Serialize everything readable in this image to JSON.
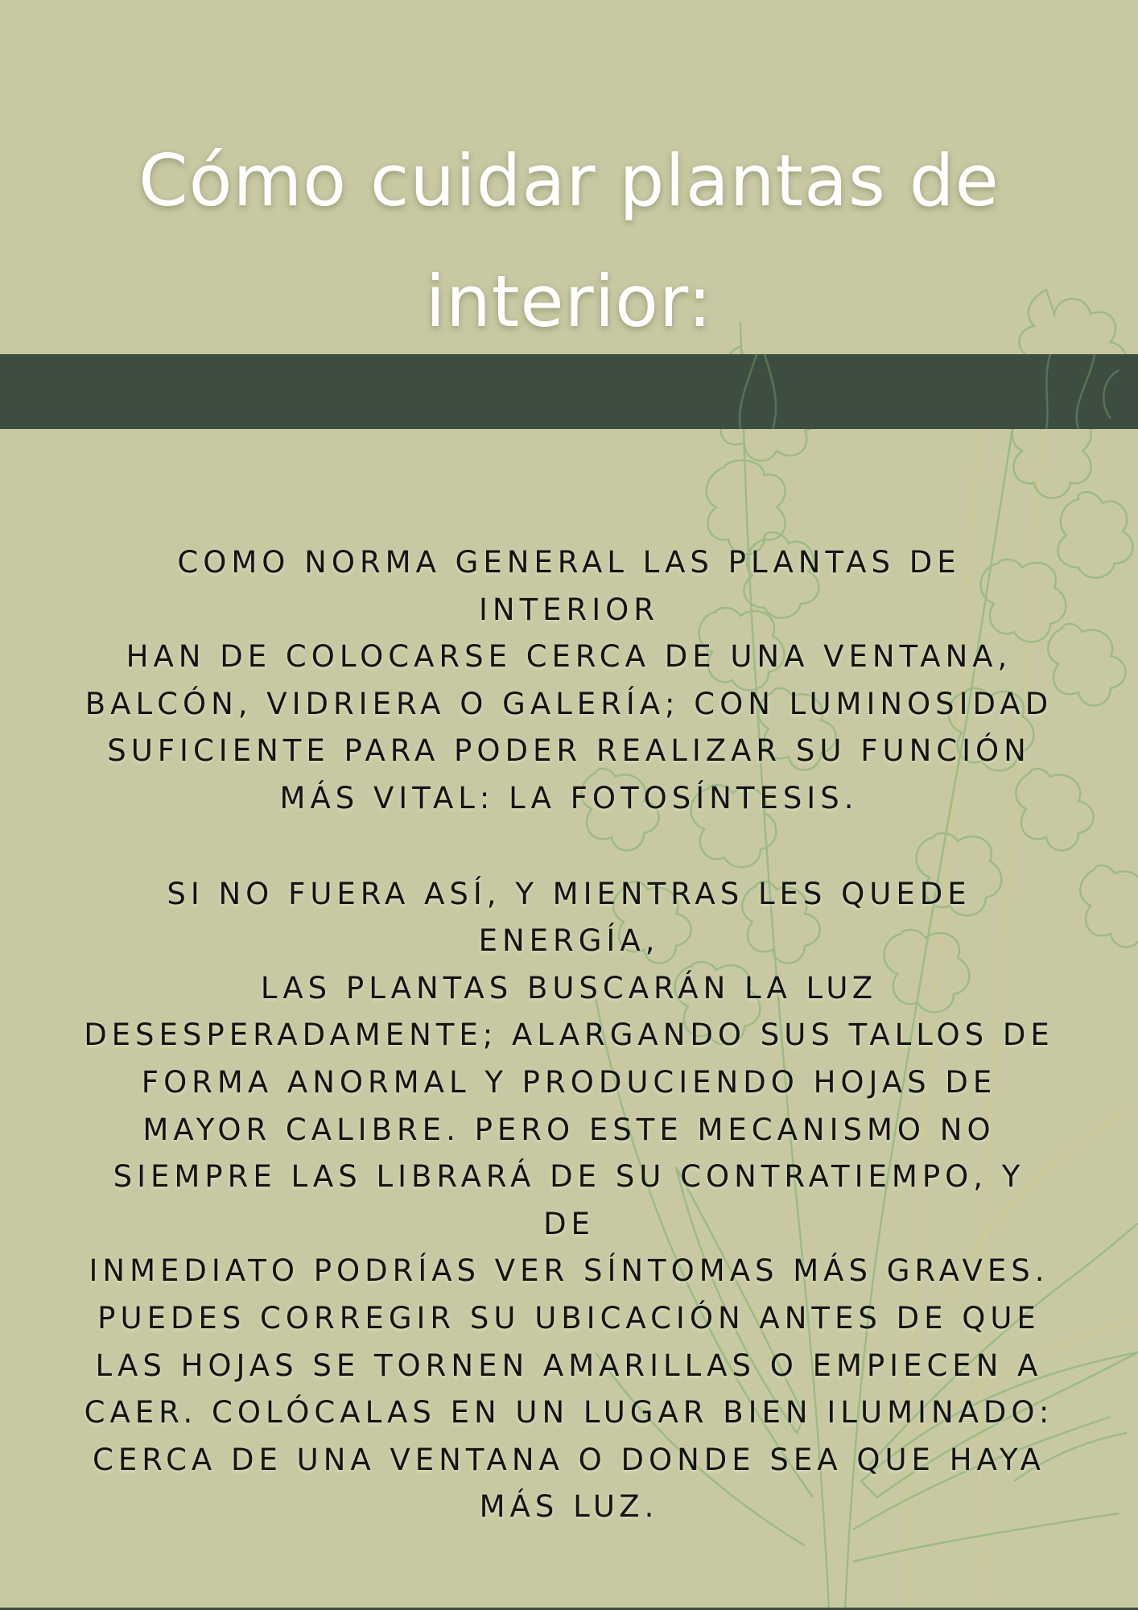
{
  "title": {
    "line1": "Cómo cuidar plantas de",
    "line2": "interior:"
  },
  "body": {
    "paragraph1": [
      "COMO NORMA GENERAL LAS PLANTAS DE INTERIOR",
      "HAN DE COLOCARSE CERCA DE UNA VENTANA,",
      "BALCÓN, VIDRIERA O GALERÍA; CON LUMINOSIDAD",
      "SUFICIENTE PARA PODER REALIZAR SU FUNCIÓN",
      "MÁS VITAL: LA FOTOSÍNTESIS."
    ],
    "paragraph2": [
      "SI NO FUERA ASÍ, Y MIENTRAS LES QUEDE ENERGÍA,",
      "LAS PLANTAS BUSCARÁN LA LUZ",
      "DESESPERADAMENTE; ALARGANDO SUS TALLOS DE",
      "FORMA ANORMAL Y PRODUCIENDO HOJAS DE",
      "MAYOR CALIBRE. PERO ESTE MECANISMO NO",
      "SIEMPRE LAS LIBRARÁ DE SU CONTRATIEMPO, Y DE",
      "INMEDIATO PODRÍAS VER SÍNTOMAS MÁS GRAVES.",
      "PUEDES CORREGIR SU UBICACIÓN ANTES DE QUE",
      "LAS HOJAS SE TORNEN AMARILLAS O EMPIECEN A",
      "CAER. COLÓCALAS EN UN LUGAR BIEN ILUMINADO:",
      "CERCA DE UNA VENTANA O DONDE SEA QUE HAYA",
      "MÁS LUZ."
    ]
  },
  "colors": {
    "background": "#c8c9a2",
    "band": "#3d4e40",
    "title_text": "#ffffff",
    "body_text": "#141414",
    "plant_line": "#9dbb84",
    "plant_line_secondary": "#d7c98f"
  },
  "decorations": {
    "illustration": "plant-line-drawing-icon"
  }
}
